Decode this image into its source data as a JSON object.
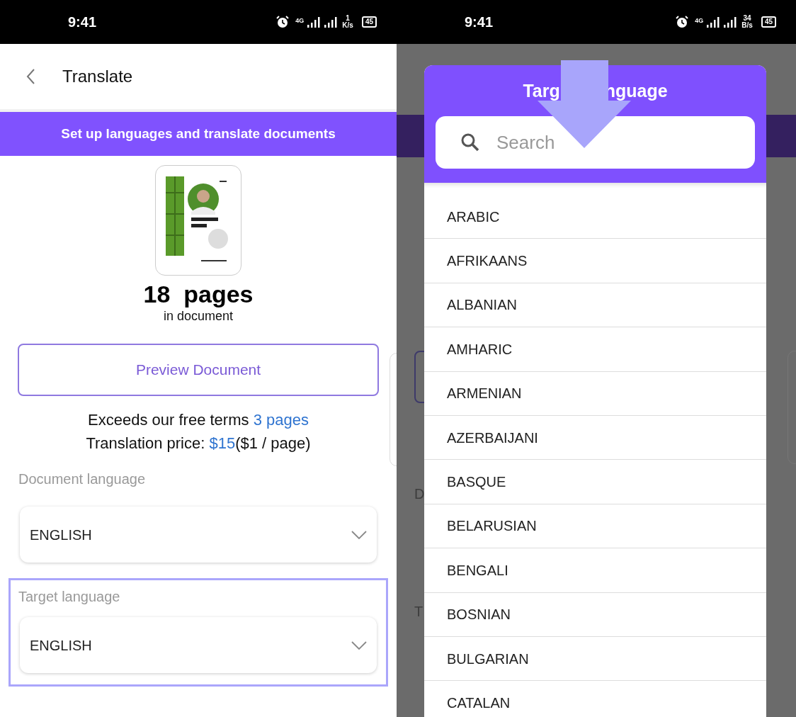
{
  "left_screen": {
    "status_bar": {
      "time": "9:41",
      "network": "4G",
      "speed_value": "1",
      "speed_unit": "K/s",
      "battery": "45"
    },
    "header": {
      "title": "Translate"
    },
    "banner": "Set up languages and translate documents",
    "document": {
      "page_count": "18  pages",
      "page_caption": "in document"
    },
    "preview_button": "Preview Document",
    "pricing": [
      {
        "text": "Exceeds our free terms ",
        "link": "3 pages"
      },
      {
        "text": "Translation price: ",
        "link": "$15",
        "after": "($1 / page)"
      }
    ],
    "document_language": {
      "label": "Document language",
      "value": "ENGLISH"
    },
    "target_language": {
      "label": "Target language",
      "value": "ENGLISH",
      "highlighted": true
    }
  },
  "right_screen": {
    "status_bar": {
      "time": "9:41",
      "network": "4G",
      "speed_value": "34",
      "speed_unit": "B/s",
      "battery": "45"
    },
    "background_labels": [
      "D",
      "T"
    ],
    "dialog": {
      "title_parts": [
        "Targ",
        "nguage"
      ],
      "search": {
        "placeholder": "Search"
      },
      "languages": [
        "ARABIC",
        "AFRIKAANS",
        "ALBANIAN",
        "AMHARIC",
        "ARMENIAN",
        "AZERBAIJANI",
        "BASQUE",
        "BELARUSIAN",
        "BENGALI",
        "BOSNIAN",
        "BULGARIAN",
        "CATALAN"
      ]
    }
  }
}
